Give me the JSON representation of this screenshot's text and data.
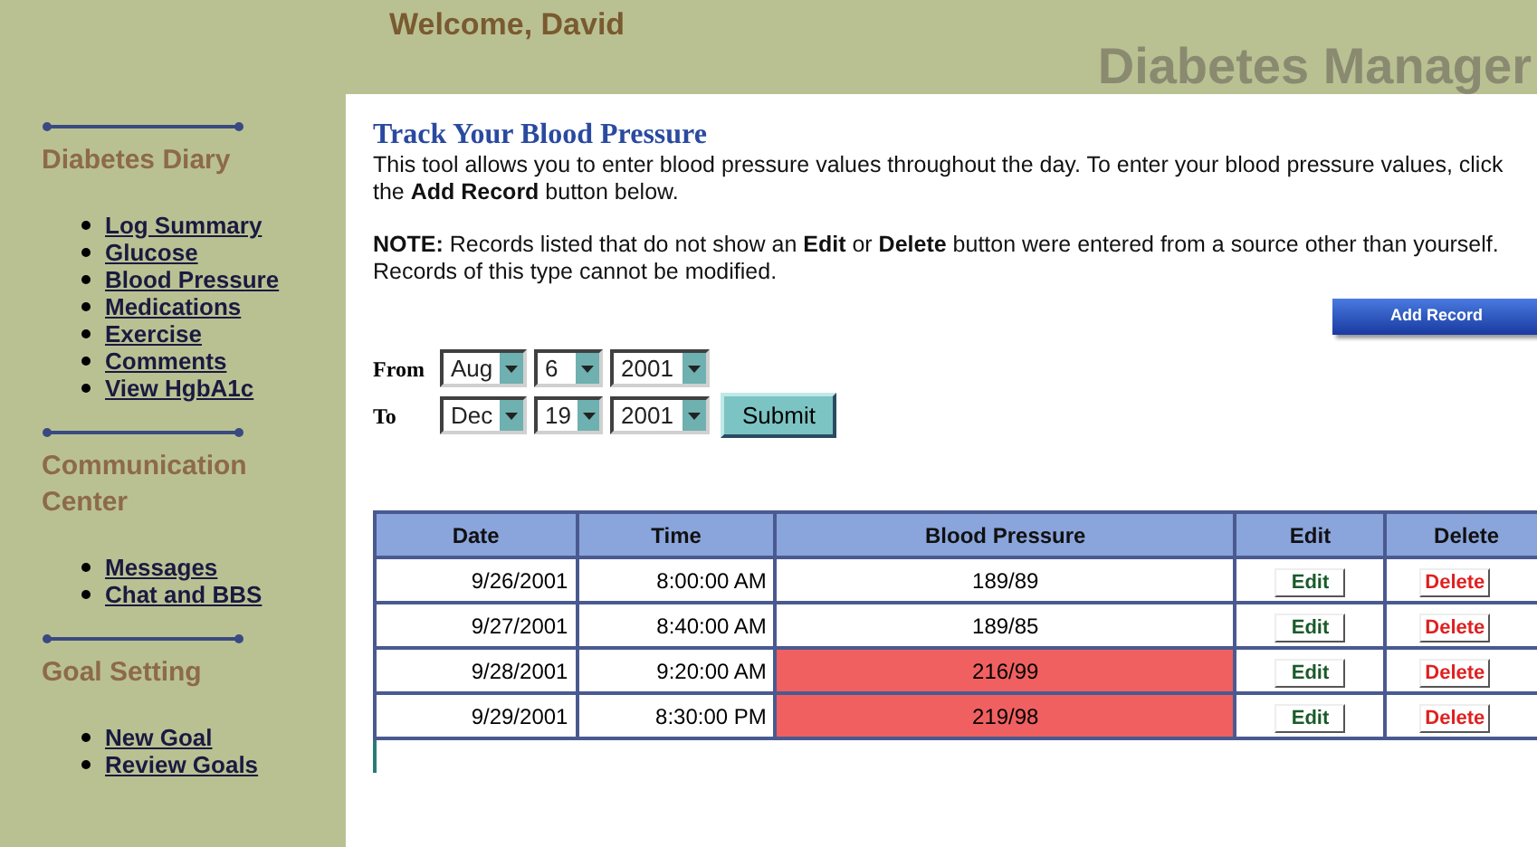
{
  "header": {
    "welcome": "Welcome, David",
    "app_title": "Diabetes Manager"
  },
  "sidebar": [
    {
      "heading": "Diabetes Diary",
      "items": [
        "Log Summary",
        "Glucose",
        "Blood Pressure",
        "Medications",
        "Exercise",
        "Comments",
        "View HgbA1c"
      ]
    },
    {
      "heading": "Communication Center",
      "items": [
        "Messages",
        "Chat and BBS"
      ]
    },
    {
      "heading": "Goal Setting",
      "items": [
        "New Goal",
        "Review Goals"
      ]
    }
  ],
  "page": {
    "title": "Track Your Blood Pressure",
    "intro": "This tool allows you to enter blood pressure values throughout the day. To enter your blood pressure values, click the **Add Record** button below.",
    "note": "**NOTE:** Records listed that do not show an **Edit** or **Delete** button were entered from a source other than yourself. Records of this type cannot be modified.",
    "add_button": "Add Record"
  },
  "filter": {
    "rows": [
      {
        "label": "From",
        "month": "Aug",
        "day": "6",
        "year": "2001"
      },
      {
        "label": "To",
        "month": "Dec",
        "day": "19",
        "year": "2001"
      }
    ],
    "submit": "Submit"
  },
  "table": {
    "columns": [
      "Date",
      "Time",
      "Blood Pressure",
      "Edit",
      "Delete"
    ],
    "rows": [
      {
        "date": "9/26/2001",
        "time": "8:00:00 AM",
        "bp": "189/89",
        "high": false,
        "edit": "Edit",
        "delete": "Delete"
      },
      {
        "date": "9/27/2001",
        "time": "8:40:00 AM",
        "bp": "189/85",
        "high": false,
        "edit": "Edit",
        "delete": "Delete"
      },
      {
        "date": "9/28/2001",
        "time": "9:20:00 AM",
        "bp": "216/99",
        "high": true,
        "edit": "Edit",
        "delete": "Delete"
      },
      {
        "date": "9/29/2001",
        "time": "8:30:00 PM",
        "bp": "219/98",
        "high": true,
        "edit": "Edit",
        "delete": "Delete"
      }
    ]
  }
}
